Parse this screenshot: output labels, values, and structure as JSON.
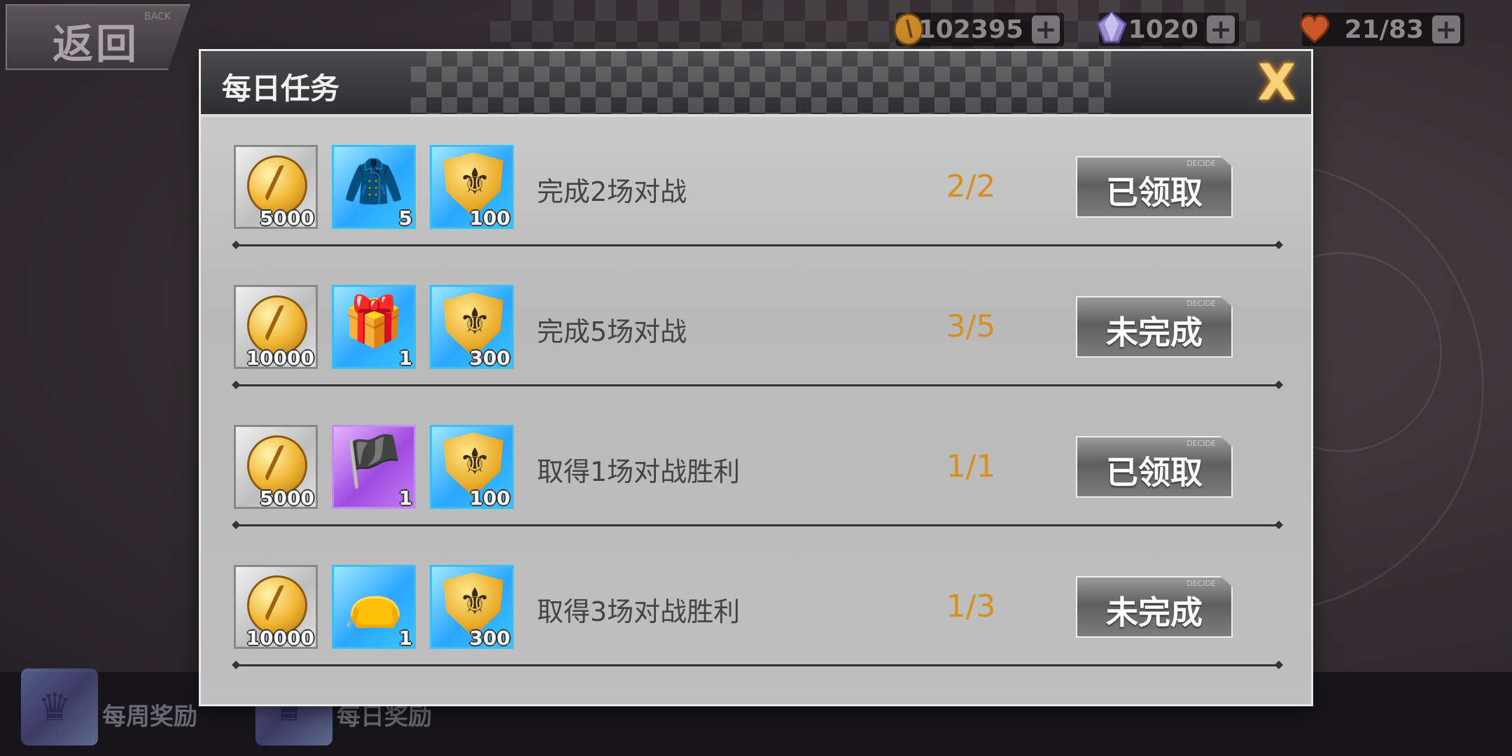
{
  "header": {
    "back_label": "返回",
    "back_sub": "BACK",
    "currencies": [
      {
        "icon": "gold-coin-icon",
        "value": "102395"
      },
      {
        "icon": "gem-icon",
        "value": "1020"
      },
      {
        "icon": "heart-icon",
        "value": "21/83"
      }
    ]
  },
  "modal": {
    "title": "每日任务",
    "close_label": "X",
    "tasks": [
      {
        "description": "完成2场对战",
        "progress": "2/2",
        "button": "已领取",
        "button_tag": "DECIDE",
        "rewards": [
          {
            "icon": "gold-coin-icon",
            "frame": "silver",
            "qty": "5000"
          },
          {
            "icon": "leather-material-icon",
            "frame": "blue",
            "qty": "5"
          },
          {
            "icon": "gold-shield-icon",
            "frame": "blue",
            "qty": "100"
          }
        ]
      },
      {
        "description": "完成5场对战",
        "progress": "3/5",
        "button": "未完成",
        "button_tag": "DECIDE",
        "rewards": [
          {
            "icon": "gold-coin-icon",
            "frame": "silver",
            "qty": "10000"
          },
          {
            "icon": "gift-box-icon",
            "frame": "blue",
            "qty": "1"
          },
          {
            "icon": "gold-shield-icon",
            "frame": "blue",
            "qty": "300"
          }
        ]
      },
      {
        "description": "取得1场对战胜利",
        "progress": "1/1",
        "button": "已领取",
        "button_tag": "DECIDE",
        "rewards": [
          {
            "icon": "gold-coin-icon",
            "frame": "silver",
            "qty": "5000"
          },
          {
            "icon": "flag-ticket-icon",
            "frame": "purple",
            "qty": "1"
          },
          {
            "icon": "gold-shield-icon",
            "frame": "blue",
            "qty": "100"
          }
        ]
      },
      {
        "description": "取得3场对战胜利",
        "progress": "1/3",
        "button": "未完成",
        "button_tag": "DECIDE",
        "rewards": [
          {
            "icon": "gold-coin-icon",
            "frame": "silver",
            "qty": "10000"
          },
          {
            "icon": "devil-bag-icon",
            "frame": "blue",
            "qty": "1"
          },
          {
            "icon": "gold-shield-icon",
            "frame": "blue",
            "qty": "300"
          }
        ]
      }
    ]
  },
  "bottom_tabs": [
    {
      "label": "每周奖励",
      "icon": "crown-cube-icon"
    },
    {
      "label": "每日奖励",
      "icon": "crown-cube-icon"
    }
  ],
  "colors": {
    "progress": "#d5901e",
    "close": "#f6d27a"
  }
}
